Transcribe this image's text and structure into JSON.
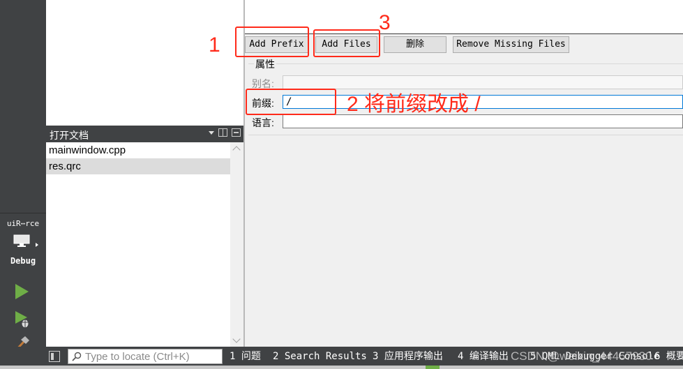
{
  "modebar": {
    "kit_label": "uiR⋯rce",
    "debug_label": "Debug"
  },
  "open_documents": {
    "title": "打开文档",
    "items": [
      "mainwindow.cpp",
      "res.qrc"
    ]
  },
  "resource_editor": {
    "buttons": {
      "add_prefix": "Add Prefix",
      "add_files": "Add Files",
      "delete": "删除",
      "remove_missing": "Remove Missing Files"
    },
    "properties_title": "属性",
    "alias_label": "别名:",
    "alias_value": "",
    "prefix_label": "前缀:",
    "prefix_value": "/",
    "language_label": "语言:",
    "language_value": ""
  },
  "annotations": {
    "step1": "1",
    "step2": "2 将前缀改成 /",
    "step3": "3"
  },
  "statusbar": {
    "locator_placeholder": "Type to locate (Ctrl+K)",
    "tabs": [
      "1 问题",
      "2 Search Results",
      "3 应用程序输出",
      "4 编译输出",
      "5 QML Debugger Console",
      "6 概要"
    ],
    "watermark": "CSDN @weixin_44457930"
  },
  "colors": {
    "annotation": "#ff2a1a",
    "dark_panel": "#404244",
    "run_green": "#6fae47"
  }
}
